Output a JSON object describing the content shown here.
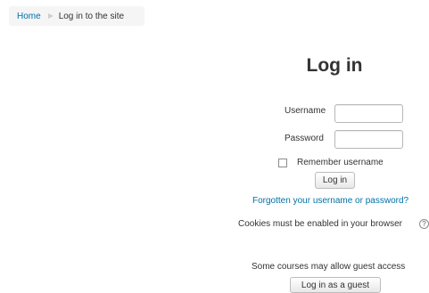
{
  "breadcrumb": {
    "home": "Home",
    "current": "Log in to the site"
  },
  "login": {
    "title": "Log in",
    "username_label": "Username",
    "username_value": "",
    "password_label": "Password",
    "password_value": "",
    "remember_label": "Remember username",
    "remember_checked": false,
    "submit_label": "Log in",
    "forgot_link": "Forgotten your username or password?",
    "cookies_notice": "Cookies must be enabled in your browser",
    "help_icon": "?"
  },
  "guest": {
    "notice": "Some courses may allow guest access",
    "button_label": "Log in as a guest"
  },
  "colors": {
    "link": "#0070a8",
    "text": "#333333",
    "breadcrumb_bg": "#f5f5f5"
  }
}
